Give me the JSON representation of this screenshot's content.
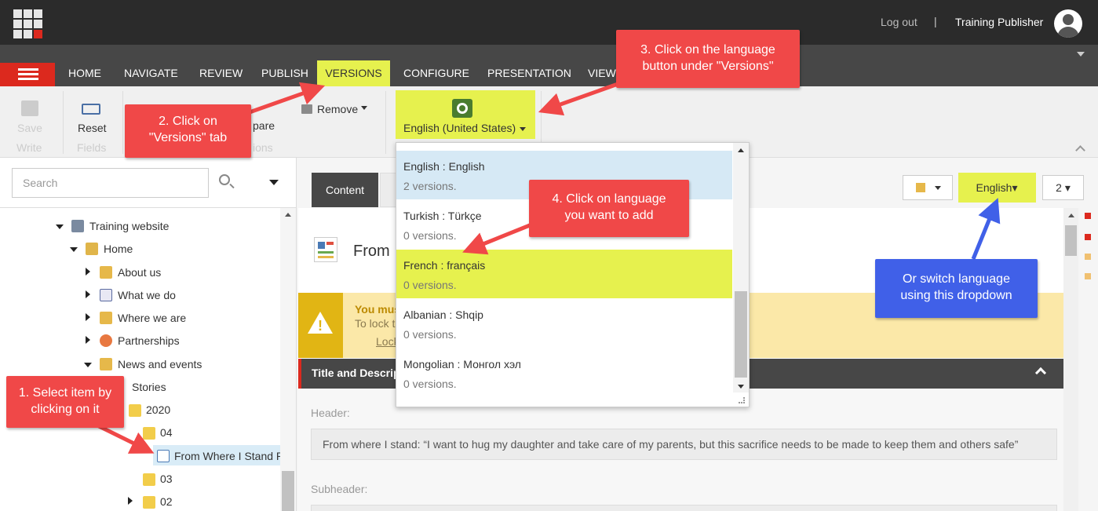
{
  "header": {
    "logout": "Log out",
    "separator": "|",
    "user": "Training Publisher"
  },
  "tabs": [
    "HOME",
    "NAVIGATE",
    "REVIEW",
    "PUBLISH",
    "VERSIONS",
    "CONFIGURE",
    "PRESENTATION",
    "VIEW"
  ],
  "selected_tab": "VERSIONS",
  "ribbon": {
    "save": "Save",
    "write": "Write",
    "reset": "Reset",
    "fields": "Fields",
    "compare_partial": "pare",
    "versions_partial": "ions",
    "remove": "Remove",
    "language": "English (United States)"
  },
  "search": {
    "placeholder": "Search"
  },
  "tree": {
    "training_website": "Training website",
    "home": "Home",
    "about_us": "About us",
    "what_we_do": "What we do",
    "where_we_are": "Where we are",
    "partnerships": "Partnerships",
    "news_and_events": "News and events",
    "stories": "Stories",
    "y2020": "2020",
    "m04": "04",
    "item": "From Where I Stand R",
    "m03": "03",
    "m02": "02"
  },
  "editor": {
    "content_tab": "Content",
    "language_button": "English",
    "version_button": "2",
    "item_title": "From",
    "warning_line1": "You mus",
    "warning_line2": "To lock t",
    "warning_link": "Lock",
    "section_title": "Title and Descrip",
    "header_label": "Header:",
    "header_value": "From where I stand: “I want to hug my daughter and take care of my parents, but this sacrifice needs to be made to keep them and others safe”",
    "subheader_label": "Subheader:"
  },
  "language_dropdown": [
    {
      "name": "English : English",
      "versions": "2 versions.",
      "state": "current"
    },
    {
      "name": "Turkish : Türkçe",
      "versions": "0 versions.",
      "state": "normal"
    },
    {
      "name": "French : français",
      "versions": "0 versions.",
      "state": "highlighted"
    },
    {
      "name": "Albanian : Shqip",
      "versions": "0 versions.",
      "state": "normal"
    },
    {
      "name": "Mongolian : Монгол хэл",
      "versions": "0 versions.",
      "state": "normal"
    }
  ],
  "callouts": {
    "step1": "1. Select item by clicking on it",
    "step2": "2. Click on \"Versions\" tab",
    "step3": "3. Click on the language button under \"Versions\"",
    "step4": "4. Click on language you want to add",
    "alt": "Or switch language using this dropdown"
  },
  "colors": {
    "highlight": "#e6f14e",
    "brand_red": "#dc291e",
    "callout_red": "#f04848",
    "callout_blue": "#4060e8",
    "topbar": "#2b2b2b",
    "tabbar": "#474747"
  }
}
